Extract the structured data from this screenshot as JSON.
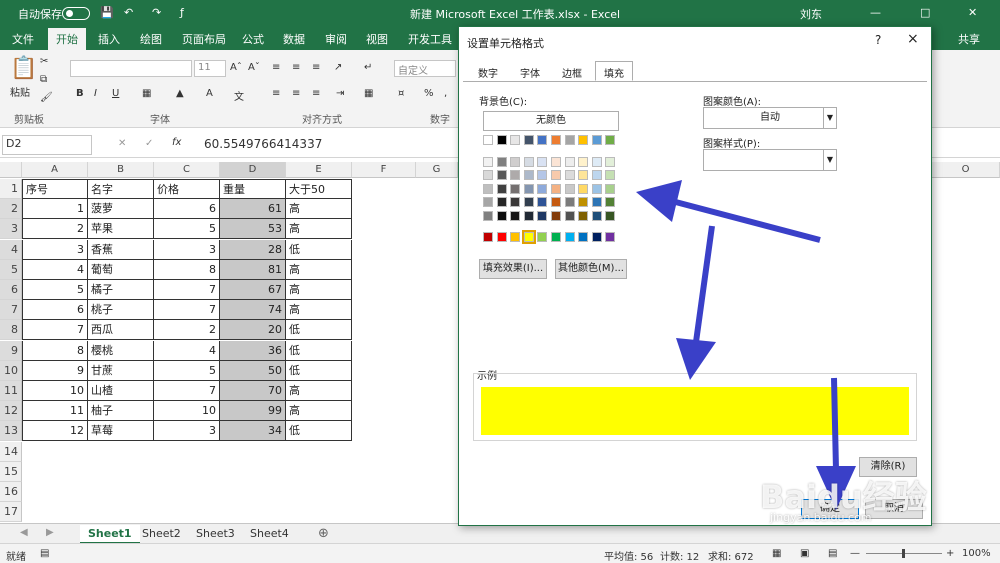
{
  "titlebar": {
    "autosave_label": "自动保存",
    "toggle_state": "关",
    "doc_title": "新建 Microsoft Excel 工作表.xlsx  -  Excel",
    "user": "刘东"
  },
  "ribbon_tabs": [
    "文件",
    "开始",
    "插入",
    "绘图",
    "页面布局",
    "公式",
    "数据",
    "审阅",
    "视图",
    "开发工具"
  ],
  "active_tab": "开始",
  "ribbon": {
    "paste_label": "粘贴",
    "groups": [
      "剪贴板",
      "字体",
      "对齐方式",
      "数字"
    ],
    "font_size": "11",
    "number_format": "自定义",
    "share_label": "共享"
  },
  "formula_bar": {
    "name_box": "D2",
    "fx": "fx",
    "value": "60.5549766414337"
  },
  "columns": [
    "A",
    "B",
    "C",
    "D",
    "E",
    "F",
    "G",
    "H",
    "O"
  ],
  "row_numbers": [
    "1",
    "2",
    "3",
    "4",
    "5",
    "6",
    "7",
    "8",
    "9",
    "10",
    "11",
    "12",
    "13",
    "14",
    "15",
    "16",
    "17"
  ],
  "table": {
    "headers": [
      "序号",
      "名字",
      "价格",
      "重量",
      "大于50"
    ],
    "rows": [
      [
        "1",
        "菠萝",
        "6",
        "61",
        "高"
      ],
      [
        "2",
        "苹果",
        "5",
        "53",
        "高"
      ],
      [
        "3",
        "香蕉",
        "3",
        "28",
        "低"
      ],
      [
        "4",
        "葡萄",
        "8",
        "81",
        "高"
      ],
      [
        "5",
        "橘子",
        "7",
        "67",
        "高"
      ],
      [
        "6",
        "桃子",
        "7",
        "74",
        "高"
      ],
      [
        "7",
        "西瓜",
        "2",
        "20",
        "低"
      ],
      [
        "8",
        "樱桃",
        "4",
        "36",
        "低"
      ],
      [
        "9",
        "甘蔗",
        "5",
        "50",
        "低"
      ],
      [
        "10",
        "山楂",
        "7",
        "70",
        "高"
      ],
      [
        "11",
        "柚子",
        "10",
        "99",
        "高"
      ],
      [
        "12",
        "草莓",
        "3",
        "34",
        "低"
      ]
    ]
  },
  "sheets": [
    "Sheet1",
    "Sheet2",
    "Sheet3",
    "Sheet4"
  ],
  "active_sheet": "Sheet1",
  "status": {
    "ready": "就绪",
    "average": "平均值: 56",
    "count": "计数: 12",
    "sum": "求和: 672",
    "zoom": "100%"
  },
  "dialog": {
    "title": "设置单元格格式",
    "help": "?",
    "close": "×",
    "tabs": [
      "数字",
      "字体",
      "边框",
      "填充"
    ],
    "active_tab": "填充",
    "bg_color_label": "背景色(C):",
    "no_color": "无颜色",
    "pattern_color_label": "图案颜色(A):",
    "pattern_color_value": "自动",
    "pattern_style_label": "图案样式(P):",
    "fill_effects": "填充效果(I)...",
    "more_colors": "其他颜色(M)...",
    "sample_label": "示例",
    "sample_color": "#FFFF00",
    "clear": "清除(R)",
    "ok": "确定",
    "cancel": "取消"
  },
  "palette": {
    "theme_row": [
      "#ffffff",
      "#000000",
      "#e7e6e6",
      "#44546a",
      "#4472c4",
      "#ed7d31",
      "#a5a5a5",
      "#ffc000",
      "#5b9bd5",
      "#70ad47"
    ],
    "tints": [
      [
        "#f2f2f2",
        "#808080",
        "#d0cece",
        "#d6dce4",
        "#d9e2f3",
        "#fbe4d5",
        "#ededed",
        "#fff2cc",
        "#deebf6",
        "#e2efd9"
      ],
      [
        "#d9d9d9",
        "#595959",
        "#aeaaaa",
        "#adb9ca",
        "#b4c6e7",
        "#f7caac",
        "#dbdbdb",
        "#fee599",
        "#bdd6ee",
        "#c5e0b3"
      ],
      [
        "#bfbfbf",
        "#404040",
        "#757070",
        "#8496b0",
        "#8eaadb",
        "#f4b183",
        "#c9c9c9",
        "#ffd966",
        "#9cc3e5",
        "#a8d08d"
      ],
      [
        "#a6a6a6",
        "#262626",
        "#3a3838",
        "#323f4f",
        "#2f5496",
        "#c55a11",
        "#7b7b7b",
        "#bf9000",
        "#2e75b5",
        "#538135"
      ],
      [
        "#808080",
        "#0d0d0d",
        "#171616",
        "#222a35",
        "#1f3864",
        "#833c0b",
        "#525252",
        "#7f6000",
        "#1e4e79",
        "#375623"
      ]
    ],
    "standard": [
      "#c00000",
      "#ff0000",
      "#ffc000",
      "#ffff00",
      "#92d050",
      "#00b050",
      "#00b0f0",
      "#0070c0",
      "#002060",
      "#7030a0"
    ],
    "selected_standard_index": 3
  },
  "arrow_color": "#3a40c8",
  "watermark": {
    "logo": "Baidu经验",
    "url": "jingyan.baidu.com"
  }
}
